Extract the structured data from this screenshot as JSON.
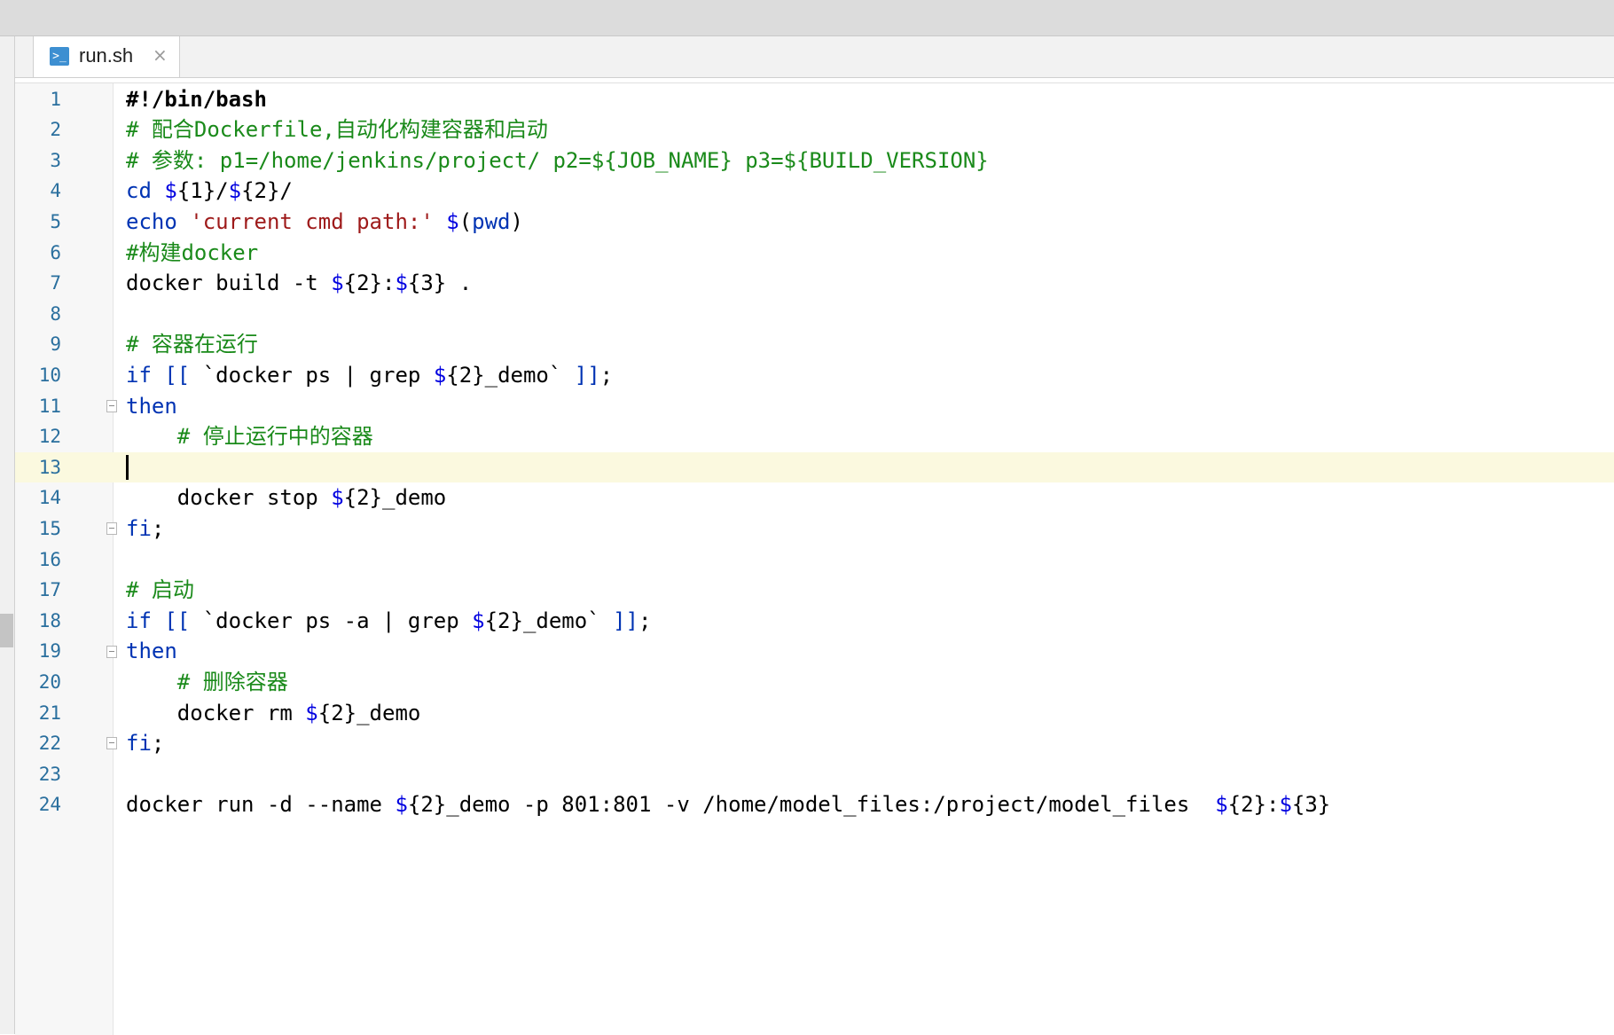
{
  "tab": {
    "icon": "terminal-icon",
    "icon_glyph": ">_",
    "label": "run.sh",
    "close": "×"
  },
  "editor": {
    "current_line": 13,
    "lines": [
      {
        "n": "1",
        "fold": false,
        "tokens": [
          {
            "t": "#!/bin/bash",
            "k": "bold"
          }
        ]
      },
      {
        "n": "2",
        "fold": false,
        "tokens": [
          {
            "t": "# 配合Dockerfile,自动化构建容器和启动",
            "k": "cmt"
          }
        ]
      },
      {
        "n": "3",
        "fold": false,
        "tokens": [
          {
            "t": "# 参数: p1=/home/jenkins/project/ p2=${JOB_NAME} p3=${BUILD_VERSION}",
            "k": "cmt"
          }
        ]
      },
      {
        "n": "4",
        "fold": false,
        "tokens": [
          {
            "t": "cd ",
            "k": "kw"
          },
          {
            "t": "$",
            "k": "var"
          },
          {
            "t": "{1}/",
            "k": "txt"
          },
          {
            "t": "$",
            "k": "var"
          },
          {
            "t": "{2}/",
            "k": "txt"
          }
        ]
      },
      {
        "n": "5",
        "fold": false,
        "tokens": [
          {
            "t": "echo ",
            "k": "kw"
          },
          {
            "t": "'current cmd path:'",
            "k": "str"
          },
          {
            "t": " ",
            "k": "txt"
          },
          {
            "t": "$",
            "k": "var"
          },
          {
            "t": "(",
            "k": "txt"
          },
          {
            "t": "pwd",
            "k": "kw"
          },
          {
            "t": ")",
            "k": "txt"
          }
        ]
      },
      {
        "n": "6",
        "fold": false,
        "tokens": [
          {
            "t": "#构建docker",
            "k": "cmt"
          }
        ]
      },
      {
        "n": "7",
        "fold": false,
        "tokens": [
          {
            "t": "docker build -t ",
            "k": "txt"
          },
          {
            "t": "$",
            "k": "var"
          },
          {
            "t": "{2}:",
            "k": "txt"
          },
          {
            "t": "$",
            "k": "var"
          },
          {
            "t": "{3} .",
            "k": "txt"
          }
        ]
      },
      {
        "n": "8",
        "fold": false,
        "tokens": []
      },
      {
        "n": "9",
        "fold": false,
        "tokens": [
          {
            "t": "# 容器在运行",
            "k": "cmt"
          }
        ]
      },
      {
        "n": "10",
        "fold": false,
        "tokens": [
          {
            "t": "if ",
            "k": "kw"
          },
          {
            "t": "[[ ",
            "k": "br"
          },
          {
            "t": "`docker ps | grep ",
            "k": "txt"
          },
          {
            "t": "$",
            "k": "var"
          },
          {
            "t": "{2}_demo` ",
            "k": "txt"
          },
          {
            "t": "]]",
            "k": "br"
          },
          {
            "t": ";",
            "k": "txt"
          }
        ]
      },
      {
        "n": "11",
        "fold": true,
        "tokens": [
          {
            "t": "then",
            "k": "kw"
          }
        ]
      },
      {
        "n": "12",
        "fold": false,
        "tokens": [
          {
            "t": "    # 停止运行中的容器",
            "k": "cmt"
          }
        ]
      },
      {
        "n": "13",
        "fold": false,
        "tokens": []
      },
      {
        "n": "14",
        "fold": false,
        "tokens": [
          {
            "t": "    docker stop ",
            "k": "txt"
          },
          {
            "t": "$",
            "k": "var"
          },
          {
            "t": "{2}_demo",
            "k": "txt"
          }
        ]
      },
      {
        "n": "15",
        "fold": true,
        "tokens": [
          {
            "t": "fi",
            "k": "kw"
          },
          {
            "t": ";",
            "k": "txt"
          }
        ]
      },
      {
        "n": "16",
        "fold": false,
        "tokens": []
      },
      {
        "n": "17",
        "fold": false,
        "tokens": [
          {
            "t": "# 启动",
            "k": "cmt"
          }
        ]
      },
      {
        "n": "18",
        "fold": false,
        "tokens": [
          {
            "t": "if ",
            "k": "kw"
          },
          {
            "t": "[[ ",
            "k": "br"
          },
          {
            "t": "`docker ps -a | grep ",
            "k": "txt"
          },
          {
            "t": "$",
            "k": "var"
          },
          {
            "t": "{2}_demo` ",
            "k": "txt"
          },
          {
            "t": "]]",
            "k": "br"
          },
          {
            "t": ";",
            "k": "txt"
          }
        ]
      },
      {
        "n": "19",
        "fold": true,
        "tokens": [
          {
            "t": "then",
            "k": "kw"
          }
        ]
      },
      {
        "n": "20",
        "fold": false,
        "tokens": [
          {
            "t": "    # 删除容器",
            "k": "cmt"
          }
        ]
      },
      {
        "n": "21",
        "fold": false,
        "tokens": [
          {
            "t": "    docker rm ",
            "k": "txt"
          },
          {
            "t": "$",
            "k": "var"
          },
          {
            "t": "{2}_demo",
            "k": "txt"
          }
        ]
      },
      {
        "n": "22",
        "fold": true,
        "tokens": [
          {
            "t": "fi",
            "k": "kw"
          },
          {
            "t": ";",
            "k": "txt"
          }
        ]
      },
      {
        "n": "23",
        "fold": false,
        "tokens": []
      },
      {
        "n": "24",
        "fold": false,
        "tokens": [
          {
            "t": "docker run -d --name ",
            "k": "txt"
          },
          {
            "t": "$",
            "k": "var"
          },
          {
            "t": "{2}_demo -p 801:801 -v /home/model_files:/project/model_files  ",
            "k": "txt"
          },
          {
            "t": "$",
            "k": "var"
          },
          {
            "t": "{2}:",
            "k": "txt"
          },
          {
            "t": "$",
            "k": "var"
          },
          {
            "t": "{3}",
            "k": "txt"
          }
        ]
      }
    ]
  },
  "colors": {
    "keyword": "#0033b3",
    "comment": "#1a8a1a",
    "string": "#9e1a1a",
    "variable": "#0000e0",
    "line_number": "#2a6f9e",
    "current_line_bg": "#fbf9df"
  }
}
